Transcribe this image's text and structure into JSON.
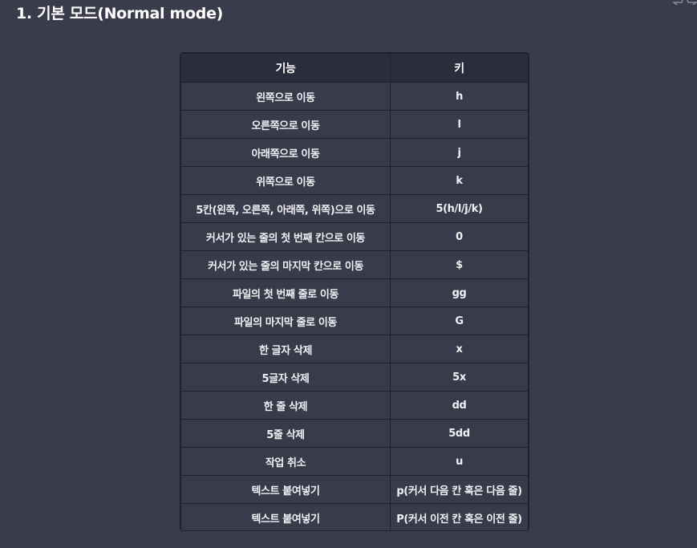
{
  "section": {
    "title": "1. 기본 모드(Normal mode)"
  },
  "table": {
    "headers": {
      "function": "기능",
      "key": "키"
    },
    "rows": [
      {
        "function": "왼쪽으로 이동",
        "key": "h"
      },
      {
        "function": "오른쪽으로 이동",
        "key": "l"
      },
      {
        "function": "아래쪽으로 이동",
        "key": "j"
      },
      {
        "function": "위쪽으로 이동",
        "key": "k"
      },
      {
        "function": "5칸(왼쪽, 오른쪽, 아래쪽, 위쪽)으로 이동",
        "key": "5(h/l/j/k)"
      },
      {
        "function": "커서가 있는 줄의 첫 번째 칸으로 이동",
        "key": "0"
      },
      {
        "function": "커서가 있는 줄의 마지막 칸으로 이동",
        "key": "$"
      },
      {
        "function": "파일의 첫 번째 줄로 이동",
        "key": "gg"
      },
      {
        "function": "파일의 마지막 줄로 이동",
        "key": "G"
      },
      {
        "function": "한 글자 삭제",
        "key": "x"
      },
      {
        "function": "5글자 삭제",
        "key": "5x"
      },
      {
        "function": "한 줄 삭제",
        "key": "dd"
      },
      {
        "function": "5줄 삭제",
        "key": "5dd"
      },
      {
        "function": "작업 취소",
        "key": "u"
      },
      {
        "function": "텍스트 붙여넣기",
        "key": "p(커서 다음 칸 혹은 다음 줄)"
      },
      {
        "function": "텍스트 붙여넣기",
        "key": "P(커서 이전 칸 혹은 이전 줄)"
      }
    ]
  },
  "icons": {
    "corner": "star-icon"
  },
  "colors": {
    "background": "#3a3c4b",
    "header_background": "#2c2d3c",
    "cell_background": "#393b4a",
    "border": "#20212a",
    "text": "#f2f3f7"
  }
}
